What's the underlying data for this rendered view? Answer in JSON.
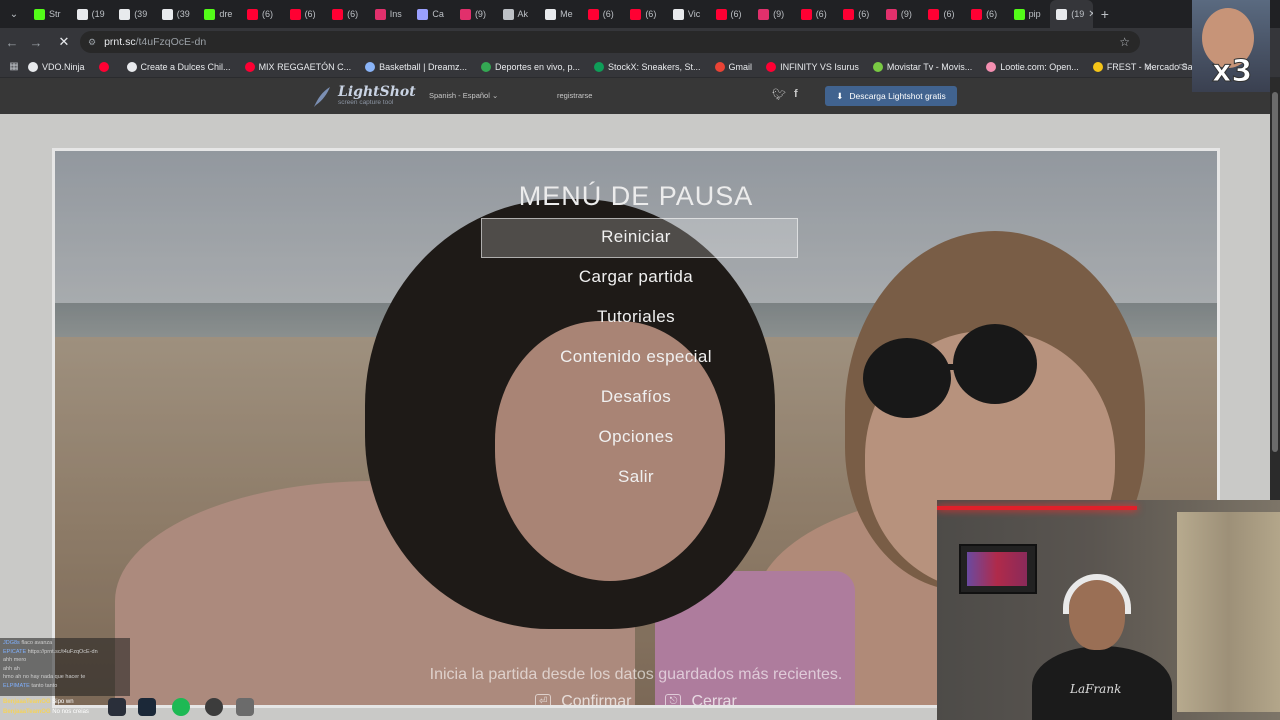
{
  "browser": {
    "tabs": [
      {
        "label": "Str",
        "icon": "kick-icon",
        "color": "#53fc18"
      },
      {
        "label": "(19",
        "icon": "x-icon",
        "color": "#e8eaed"
      },
      {
        "label": "(39",
        "icon": "tiktok-icon",
        "color": "#e8eaed"
      },
      {
        "label": "(39",
        "icon": "tiktok-icon",
        "color": "#e8eaed"
      },
      {
        "label": "dre",
        "icon": "kick-icon",
        "color": "#53fc18"
      },
      {
        "label": "(6)",
        "icon": "youtube-icon",
        "color": "#ff0033"
      },
      {
        "label": "(6)",
        "icon": "youtube-icon",
        "color": "#ff0033"
      },
      {
        "label": "(6)",
        "icon": "youtube-icon",
        "color": "#ff0033"
      },
      {
        "label": "Ins",
        "icon": "instagram-icon",
        "color": "#e1306c"
      },
      {
        "label": "Ca",
        "icon": "lightshot-icon",
        "color": "#9aa0ff"
      },
      {
        "label": "(9)",
        "icon": "instagram-icon",
        "color": "#e1306c"
      },
      {
        "label": "Ak",
        "icon": "chrome-icon",
        "color": "#bdc1c6"
      },
      {
        "label": "Me",
        "icon": "tiktok-icon",
        "color": "#e8eaed"
      },
      {
        "label": "(6)",
        "icon": "youtube-icon",
        "color": "#ff0033"
      },
      {
        "label": "(6)",
        "icon": "youtube-icon",
        "color": "#ff0033"
      },
      {
        "label": "Vic",
        "icon": "tiktok-icon",
        "color": "#e8eaed"
      },
      {
        "label": "(6)",
        "icon": "youtube-icon",
        "color": "#ff0033"
      },
      {
        "label": "(9)",
        "icon": "instagram-icon",
        "color": "#e1306c"
      },
      {
        "label": "(6)",
        "icon": "youtube-icon",
        "color": "#ff0033"
      },
      {
        "label": "(6)",
        "icon": "youtube-icon",
        "color": "#ff0033"
      },
      {
        "label": "(9)",
        "icon": "instagram-icon",
        "color": "#e1306c"
      },
      {
        "label": "(6)",
        "icon": "youtube-icon",
        "color": "#ff0033"
      },
      {
        "label": "(6)",
        "icon": "youtube-icon",
        "color": "#ff0033"
      },
      {
        "label": "pip",
        "icon": "kick-icon",
        "color": "#53fc18"
      },
      {
        "label": "(19",
        "icon": "x-icon",
        "color": "#e8eaed"
      }
    ],
    "new_tab": "+",
    "address": {
      "host": "prnt.sc",
      "path": "/t4uFzqOcE-dn"
    },
    "bookmarks": [
      {
        "label": "VDO.Ninja",
        "color": "#e8eaed"
      },
      {
        "label": "",
        "color": "#ff0033"
      },
      {
        "label": "Create a Dulces Chil...",
        "color": "#e8eaed"
      },
      {
        "label": "MIX REGGAETÓN C...",
        "color": "#ff0033"
      },
      {
        "label": "Basketball | Dreamz...",
        "color": "#8ab4f8"
      },
      {
        "label": "Deportes en vivo, p...",
        "color": "#34a853"
      },
      {
        "label": "StockX: Sneakers, St...",
        "color": "#0f9d58"
      },
      {
        "label": "Gmail",
        "color": "#ea4335"
      },
      {
        "label": "INFINITY VS Isurus",
        "color": "#ff0033"
      },
      {
        "label": "Movistar Tv - Movis...",
        "color": "#79c943"
      },
      {
        "label": "Lootie.com: Open...",
        "color": "#f48fb1"
      },
      {
        "label": "FREST - Mercado Sa...",
        "color": "#f5c518"
      }
    ]
  },
  "lightshot": {
    "logo": "LightShot",
    "logo_sub": "screen capture tool",
    "language": "Spanish - Español",
    "register": "registrarse",
    "download": "Descarga Lightshot gratis"
  },
  "pause_menu": {
    "title": "MENÚ DE PAUSA",
    "items": [
      "Reiniciar",
      "Cargar partida",
      "Tutoriales",
      "Contenido especial",
      "Desafíos",
      "Opciones",
      "Salir"
    ],
    "hint": "Inicia la partida desde los datos guardados más recientes.",
    "confirm": "Confirmar",
    "close": "Cerrar"
  },
  "stream": {
    "multiplier": "x3",
    "shirt_text": "LaFrank",
    "chat": [
      {
        "user": "JDG8s",
        "text": "flaco avanza"
      },
      {
        "user": "EPICATE",
        "text": "https://prnt.sc/t4uFzqOcE-dn"
      },
      {
        "user": "",
        "text": "ahh mero"
      },
      {
        "user": "",
        "text": "ahh ah"
      },
      {
        "user": "",
        "text": "hmo ah no hay nada que hacer te"
      },
      {
        "user": "ELPIMATE",
        "text": "tanto tanto"
      }
    ],
    "chat_bottom": [
      {
        "user": "BenjaaaTeamOG",
        "text": "Sipo wn"
      },
      {
        "user": "BenjaaaTeamOG",
        "text": "No nos creias"
      }
    ]
  }
}
